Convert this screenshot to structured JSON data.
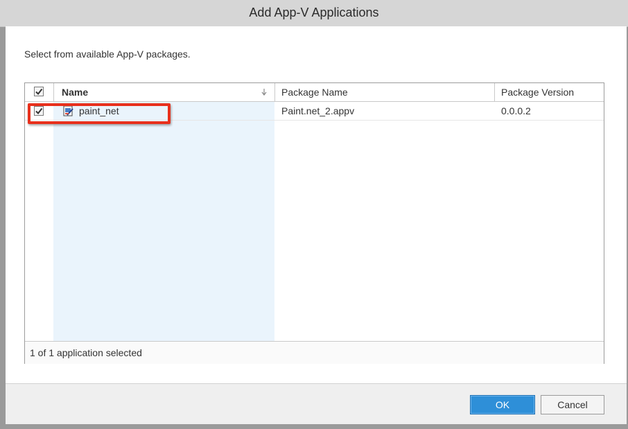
{
  "window": {
    "title": "Add App-V Applications"
  },
  "instruction": "Select from available App-V packages.",
  "table": {
    "select_all_checked": true,
    "columns": [
      {
        "label": "Name",
        "sort_icon": "sort-descending-icon"
      },
      {
        "label": "Package Name"
      },
      {
        "label": "Package Version"
      }
    ],
    "rows": [
      {
        "checked": true,
        "icon": "appv-package-icon",
        "name": "paint_net",
        "package_name": "Paint.net_2.appv",
        "package_version": "0.0.0.2",
        "highlighted": true
      }
    ],
    "status": "1 of 1 application selected"
  },
  "buttons": {
    "ok": "OK",
    "cancel": "Cancel"
  },
  "colors": {
    "highlight": "#e8301c",
    "ok_button": "#2e8fd8",
    "name_column_shade": "#eaf4fc"
  }
}
